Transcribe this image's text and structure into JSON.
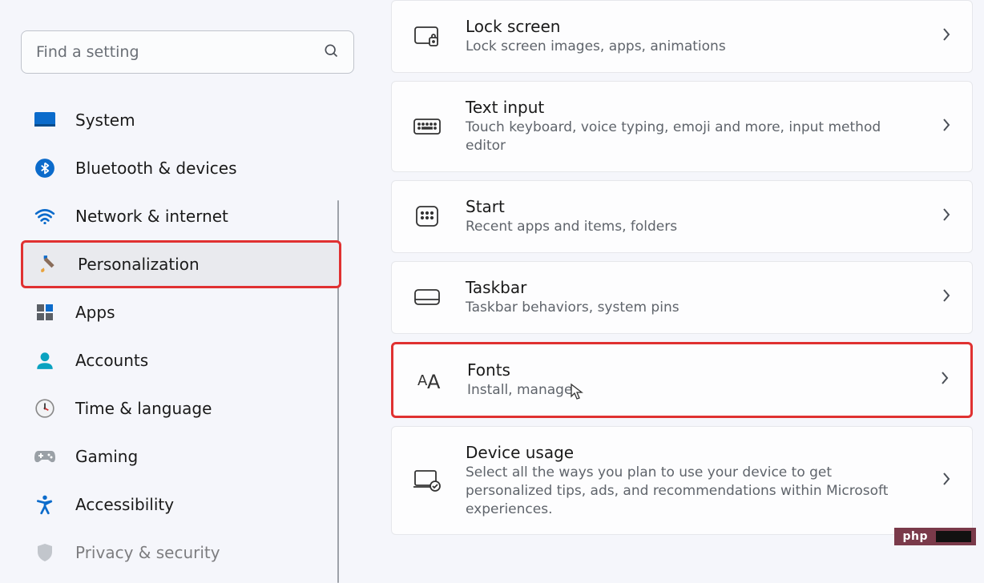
{
  "search": {
    "placeholder": "Find a setting"
  },
  "sidebar": {
    "items": [
      {
        "label": "System"
      },
      {
        "label": "Bluetooth & devices"
      },
      {
        "label": "Network & internet"
      },
      {
        "label": "Personalization"
      },
      {
        "label": "Apps"
      },
      {
        "label": "Accounts"
      },
      {
        "label": "Time & language"
      },
      {
        "label": "Gaming"
      },
      {
        "label": "Accessibility"
      },
      {
        "label": "Privacy & security"
      }
    ]
  },
  "cards": [
    {
      "title": "Lock screen",
      "desc": "Lock screen images, apps, animations"
    },
    {
      "title": "Text input",
      "desc": "Touch keyboard, voice typing, emoji and more, input method editor"
    },
    {
      "title": "Start",
      "desc": "Recent apps and items, folders"
    },
    {
      "title": "Taskbar",
      "desc": "Taskbar behaviors, system pins"
    },
    {
      "title": "Fonts",
      "desc": "Install, manage"
    },
    {
      "title": "Device usage",
      "desc": "Select all the ways you plan to use your device to get personalized tips, ads, and recommendations within Microsoft experiences."
    }
  ],
  "watermark": {
    "text": "php"
  }
}
